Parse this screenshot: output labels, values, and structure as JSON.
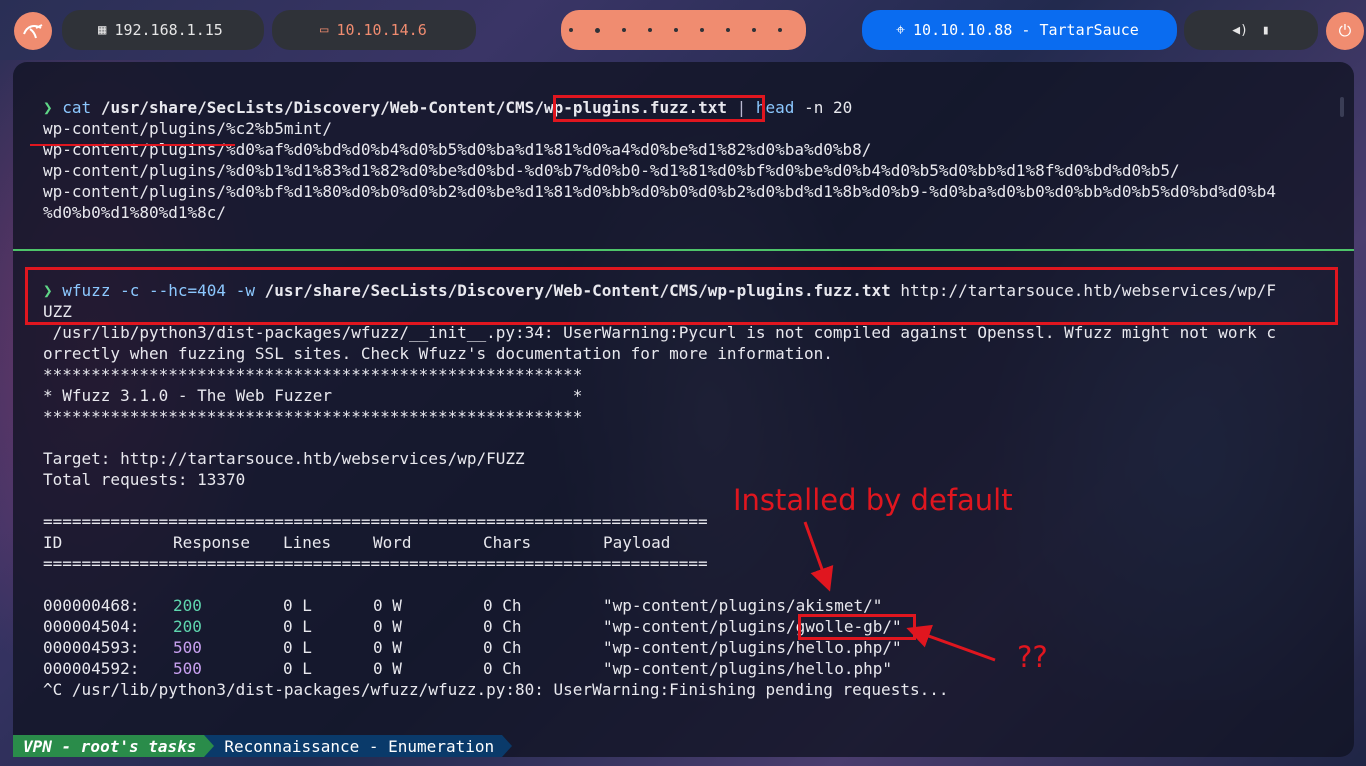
{
  "topbar": {
    "local_ip": "192.168.1.15",
    "vpn_ip": "10.10.14.6",
    "target": "10.10.10.88 - TartarSauce",
    "colors": {
      "accent": "#f08c70",
      "target_bg": "#0a6cf0",
      "pill_bg": "#2f3238"
    }
  },
  "terminal": {
    "cmd1": {
      "prompt": "❯",
      "cmd": "cat",
      "path_prefix": "/usr/share/SecLists/Discovery/Web-Content/CMS",
      "path_file": "/wp-plugins.fuzz.txt",
      "pipe": "|",
      "cmd2": "head",
      "args": "-n 20"
    },
    "out1": [
      "wp-content/plugins/%c2%b5mint/",
      "wp-content/plugins/%d0%af%d0%bd%d0%b4%d0%b5%d0%ba%d1%81%d0%a4%d0%be%d1%82%d0%ba%d0%b8/",
      "wp-content/plugins/%d0%b1%d1%83%d1%82%d0%be%d0%bd-%d0%b7%d0%b0-%d1%81%d0%bf%d0%be%d0%b4%d0%b5%d0%bb%d1%8f%d0%bd%d0%b5/",
      "wp-content/plugins/%d0%bf%d1%80%d0%b0%d0%b2%d0%be%d1%81%d0%bb%d0%b0%d0%b2%d0%bd%d1%8b%d0%b9-%d0%ba%d0%b0%d0%bb%d0%b5%d0%bd%d0%b4",
      "%d0%b0%d1%80%d1%8c/"
    ],
    "cmd2": {
      "prompt": "❯",
      "cmd": "wfuzz",
      "args": "-c --hc=404 -w",
      "path": "/usr/share/SecLists/Discovery/Web-Content/CMS/wp-plugins.fuzz.txt",
      "url_line1": "http://tartarsouce.htb/webservices/wp/F",
      "url_line2": "UZZ"
    },
    "warning": [
      " /usr/lib/python3/dist-packages/wfuzz/__init__.py:34: UserWarning:Pycurl is not compiled against Openssl. Wfuzz might not work c",
      "orrectly when fuzzing SSL sites. Check Wfuzz's documentation for more information."
    ],
    "banner": [
      "********************************************************",
      "* Wfuzz 3.1.0 - The Web Fuzzer                         *",
      "********************************************************"
    ],
    "target_line": "Target: http://tartarsouce.htb/webservices/wp/FUZZ",
    "total_line": "Total requests: 13370",
    "sep": "=====================================================================",
    "columns": [
      "ID",
      "Response",
      "Lines",
      "Word",
      "Chars",
      "Payload"
    ],
    "rows": [
      {
        "id": "000000468:",
        "response": "200",
        "lines": "0 L",
        "word": "0 W",
        "chars": "0 Ch",
        "payload": "\"wp-content/plugins/akismet/\""
      },
      {
        "id": "000004504:",
        "response": "200",
        "lines": "0 L",
        "word": "0 W",
        "chars": "0 Ch",
        "payload": "\"wp-content/plugins/gwolle-gb/\""
      },
      {
        "id": "000004593:",
        "response": "500",
        "lines": "0 L",
        "word": "0 W",
        "chars": "0 Ch",
        "payload": "\"wp-content/plugins/hello.php/\""
      },
      {
        "id": "000004592:",
        "response": "500",
        "lines": "0 L",
        "word": "0 W",
        "chars": "0 Ch",
        "payload": "\"wp-content/plugins/hello.php\""
      }
    ],
    "final_line": "^C /usr/lib/python3/dist-packages/wfuzz/wfuzz.py:80: UserWarning:Finishing pending requests..."
  },
  "annotations": {
    "installed": "Installed by default",
    "question": "??",
    "color": "#e0161f"
  },
  "statusbar": {
    "session": "VPN - root's tasks",
    "window": "Reconnaissance - Enumeration"
  }
}
